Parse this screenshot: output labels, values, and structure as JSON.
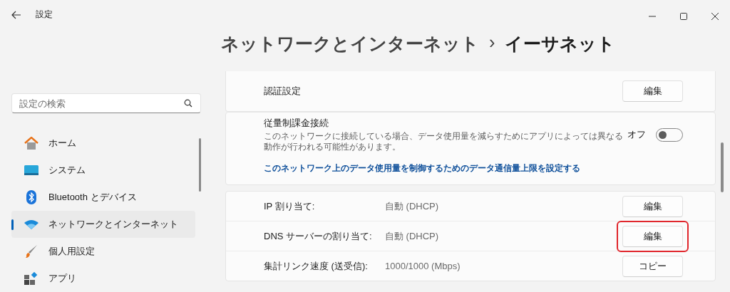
{
  "window": {
    "title": "設定"
  },
  "search": {
    "placeholder": "設定の検索"
  },
  "sidebar": {
    "items": [
      {
        "label": "ホーム",
        "selected": false
      },
      {
        "label": "システム",
        "selected": false
      },
      {
        "label": "Bluetooth とデバイス",
        "selected": false
      },
      {
        "label": "ネットワークとインターネット",
        "selected": true
      },
      {
        "label": "個人用設定",
        "selected": false
      },
      {
        "label": "アプリ",
        "selected": false
      }
    ]
  },
  "breadcrumb": {
    "parent": "ネットワークとインターネット",
    "separator": "›",
    "current": "イーサネット"
  },
  "cards": [
    {
      "kind": "button_row",
      "label": "認証設定",
      "button": {
        "label": "編集",
        "highlighted": false
      }
    },
    {
      "kind": "toggle",
      "label": "従量制課金接続",
      "description": "このネットワークに接続している場合、データ使用量を減らすためにアプリによっては異なる動作が行われる可能性があります。",
      "state_label": "オフ",
      "on": false,
      "link": "このネットワーク上のデータ使用量を制御するためのデータ通信量上限を設定する"
    },
    {
      "kind": "details",
      "rows": [
        {
          "label": "IP 割り当て:",
          "value": "自動 (DHCP)",
          "button": {
            "label": "編集",
            "highlighted": false
          }
        },
        {
          "label": "DNS サーバーの割り当て:",
          "value": "自動 (DHCP)",
          "button": {
            "label": "編集",
            "highlighted": true
          }
        },
        {
          "label": "集計リンク速度 (送受信):",
          "value": "1000/1000 (Mbps)",
          "button": {
            "label": "コピー",
            "highlighted": false
          }
        }
      ]
    }
  ]
}
